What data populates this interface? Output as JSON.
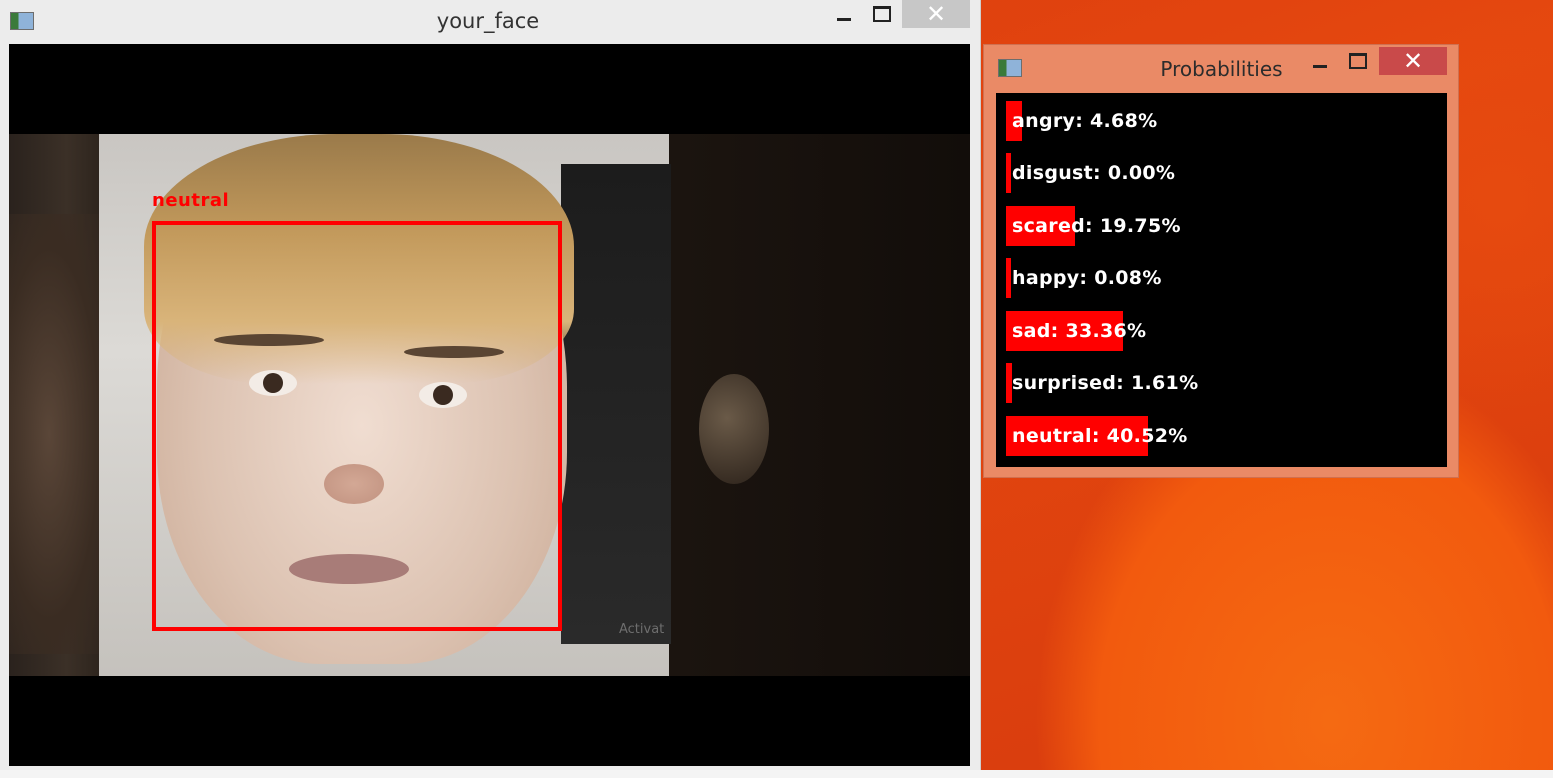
{
  "main_window": {
    "title": "your_face",
    "face_label": "neutral",
    "background_text": "Activat"
  },
  "probabilities_window": {
    "title": "Probabilities",
    "emotions": [
      {
        "label": "angry: 4.68%",
        "probability": 4.68
      },
      {
        "label": "disgust: 0.00%",
        "probability": 0.0
      },
      {
        "label": "scared: 19.75%",
        "probability": 19.75
      },
      {
        "label": "happy: 0.08%",
        "probability": 0.08
      },
      {
        "label": "sad: 33.36%",
        "probability": 33.36
      },
      {
        "label": "surprised: 1.61%",
        "probability": 1.61
      },
      {
        "label": "neutral: 40.52%",
        "probability": 40.52
      }
    ],
    "bar_color": "#ff0000"
  },
  "colors": {
    "detection_box": "#ff0000",
    "desktop_accent": "#e5480f"
  }
}
